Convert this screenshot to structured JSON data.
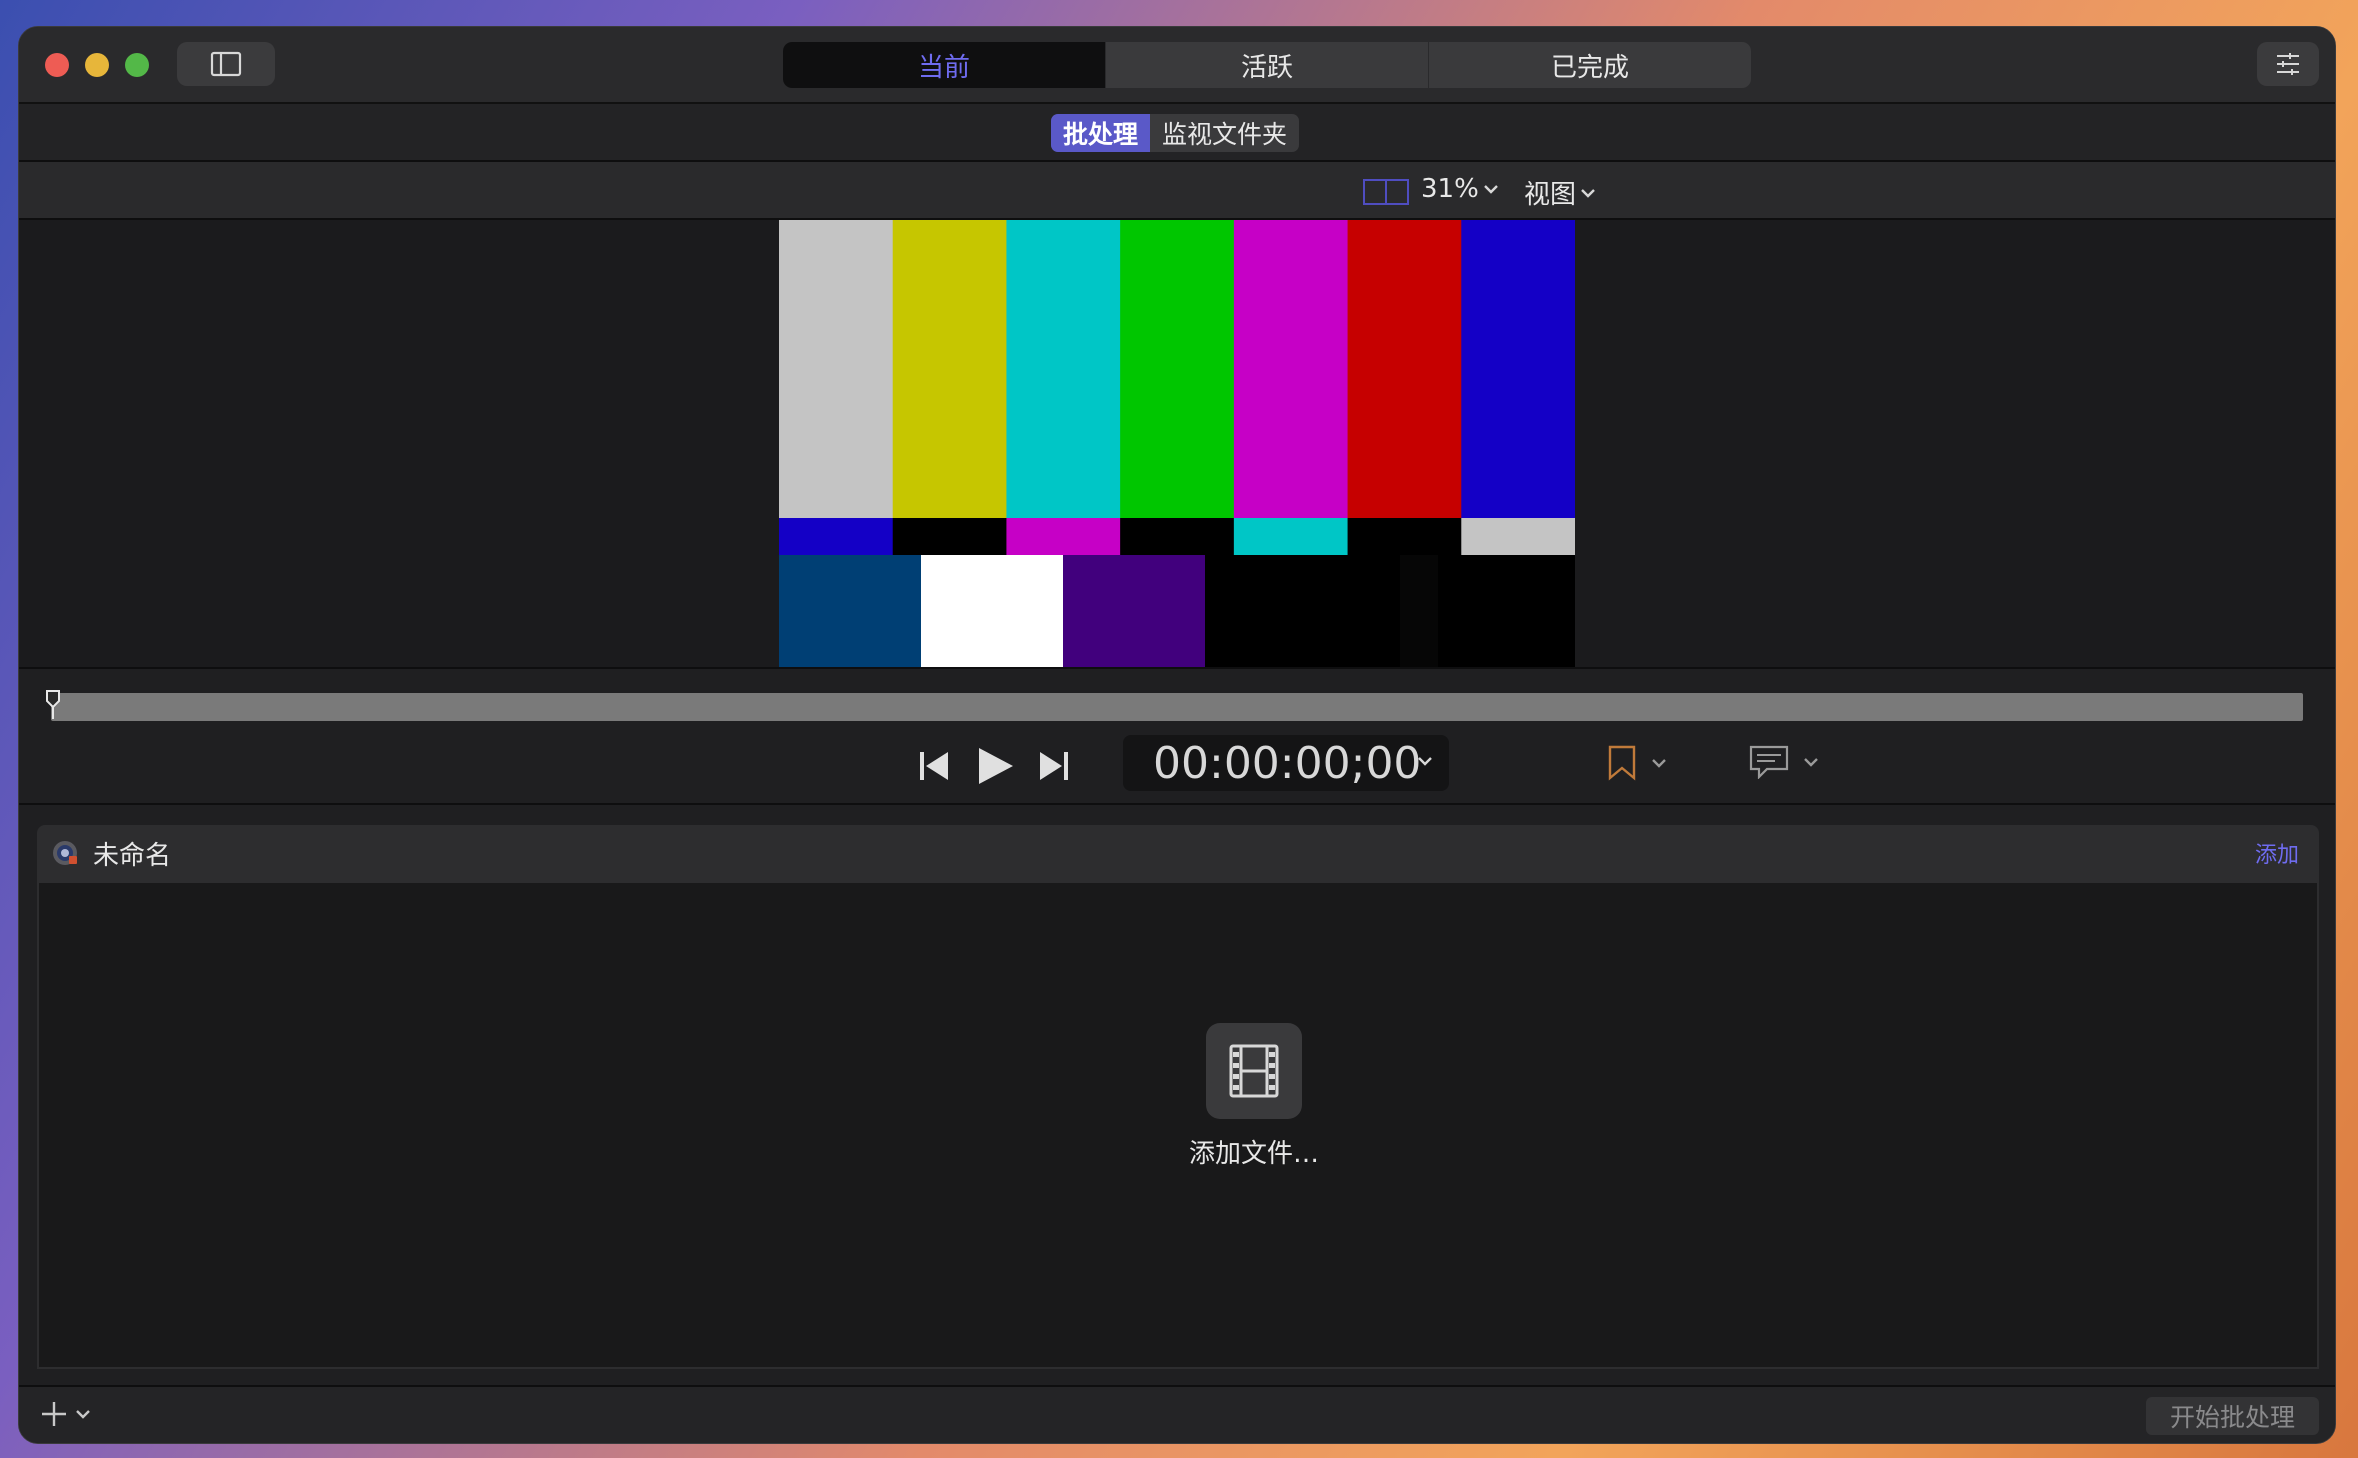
{
  "tabs": [
    {
      "label": "当前",
      "active": true
    },
    {
      "label": "活跃",
      "active": false
    },
    {
      "label": "已完成",
      "active": false
    }
  ],
  "subtabs": [
    {
      "label": "批处理",
      "active": true
    },
    {
      "label": "监视文件夹",
      "active": false
    }
  ],
  "viewer": {
    "zoom": "31%",
    "view_label": "视图"
  },
  "color_bars": {
    "top": [
      "#c4c4c4",
      "#c6c600",
      "#00c6c6",
      "#00c600",
      "#c600c6",
      "#c60000",
      "#1400c6"
    ],
    "middle": [
      "#1400c6",
      "#000000",
      "#c600c6",
      "#000000",
      "#00c6c6",
      "#000000",
      "#c4c4c4"
    ],
    "bottom": [
      "#003f74",
      "#ffffff",
      "#41007d",
      "#000000",
      "#000000",
      "#000000",
      "#060606",
      "#000000"
    ]
  },
  "transport": {
    "timecode": "00:00:00;00"
  },
  "batch": {
    "title": "未命名",
    "add_label": "添加",
    "add_files_label": "添加文件…"
  },
  "footer": {
    "start_label": "开始批处理"
  },
  "colors": {
    "accent": "#6f6cf0",
    "marker": "#c07a3a"
  }
}
